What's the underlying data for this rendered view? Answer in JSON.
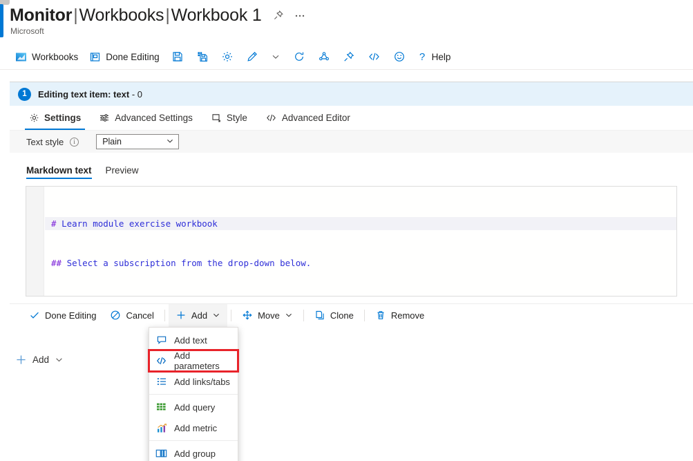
{
  "header": {
    "title_main": "Monitor",
    "title_sep1": "|",
    "title_part2": "Workbooks",
    "title_sep2": "|",
    "title_part3": "Workbook 1",
    "subtitle": "Microsoft",
    "pin_icon": "pin-icon",
    "more_icon": "ellipsis-icon"
  },
  "command_bar": {
    "items": [
      {
        "label": "Workbooks",
        "icon": "workbooks-icon"
      },
      {
        "label": "Done Editing",
        "icon": "done-editing-icon"
      },
      {
        "label": "",
        "icon": "save-icon"
      },
      {
        "label": "",
        "icon": "save-as-icon"
      },
      {
        "label": "",
        "icon": "gear-icon"
      },
      {
        "label": "",
        "icon": "edit-pencil-icon"
      },
      {
        "label": "",
        "icon": "chevron-down-icon"
      },
      {
        "label": "",
        "icon": "refresh-icon"
      },
      {
        "label": "",
        "icon": "share-icon"
      },
      {
        "label": "",
        "icon": "pin-icon"
      },
      {
        "label": "",
        "icon": "code-icon"
      },
      {
        "label": "",
        "icon": "feedback-smiley-icon"
      },
      {
        "label": "Help",
        "icon": "question-mark-icon"
      }
    ]
  },
  "panel": {
    "badge": "1",
    "head_label": "Editing text item: text",
    "head_suffix": "- 0",
    "tabs": [
      {
        "label": "Settings",
        "icon": "gear-icon",
        "active": true
      },
      {
        "label": "Advanced Settings",
        "icon": "sliders-icon",
        "active": false
      },
      {
        "label": "Style",
        "icon": "style-icon",
        "active": false
      },
      {
        "label": "Advanced Editor",
        "icon": "code-icon",
        "active": false
      }
    ],
    "text_style": {
      "label": "Text style",
      "info_icon": "info-icon",
      "value": "Plain",
      "chevron": "chevron-down-icon"
    },
    "editor_tabs": [
      {
        "label": "Markdown text",
        "active": true
      },
      {
        "label": "Preview",
        "active": false
      }
    ],
    "code": {
      "line1_hash": "# ",
      "line1_text": "Learn module exercise workbook",
      "line2_hash": "## ",
      "line2_text": "Select a subscription from the drop-down below."
    }
  },
  "action_bar": {
    "items": [
      {
        "label": "Done Editing",
        "icon": "checkmark-icon"
      },
      {
        "label": "Cancel",
        "icon": "cancel-circle-icon"
      },
      {
        "label": "Add",
        "icon": "plus-icon",
        "chevron": "chevron-down-icon"
      },
      {
        "label": "Move",
        "icon": "move-arrows-icon",
        "chevron": "chevron-down-icon"
      },
      {
        "label": "Clone",
        "icon": "copy-icon"
      },
      {
        "label": "Remove",
        "icon": "trash-icon"
      }
    ]
  },
  "footer": {
    "add_label": "Add",
    "plus_icon": "plus-icon",
    "chevron": "chevron-down-icon"
  },
  "add_menu": {
    "items": [
      {
        "label": "Add text",
        "icon": "speech-bubble-icon",
        "highlighted": false
      },
      {
        "label": "Add parameters",
        "icon": "code-icon",
        "highlighted": true
      },
      {
        "label": "Add links/tabs",
        "icon": "list-icon",
        "highlighted": false
      },
      {
        "label": "Add query",
        "icon": "grid-green-icon",
        "highlighted": false
      },
      {
        "label": "Add metric",
        "icon": "chart-icon",
        "highlighted": false
      },
      {
        "label": "Add group",
        "icon": "group-panel-icon",
        "highlighted": false
      }
    ]
  },
  "colors": {
    "accent": "#0078d4",
    "panel_head_bg": "#e5f2fb",
    "highlight_red": "#e8232a",
    "code_blue": "#2f2fd8",
    "code_purple": "#7a1fd8"
  }
}
